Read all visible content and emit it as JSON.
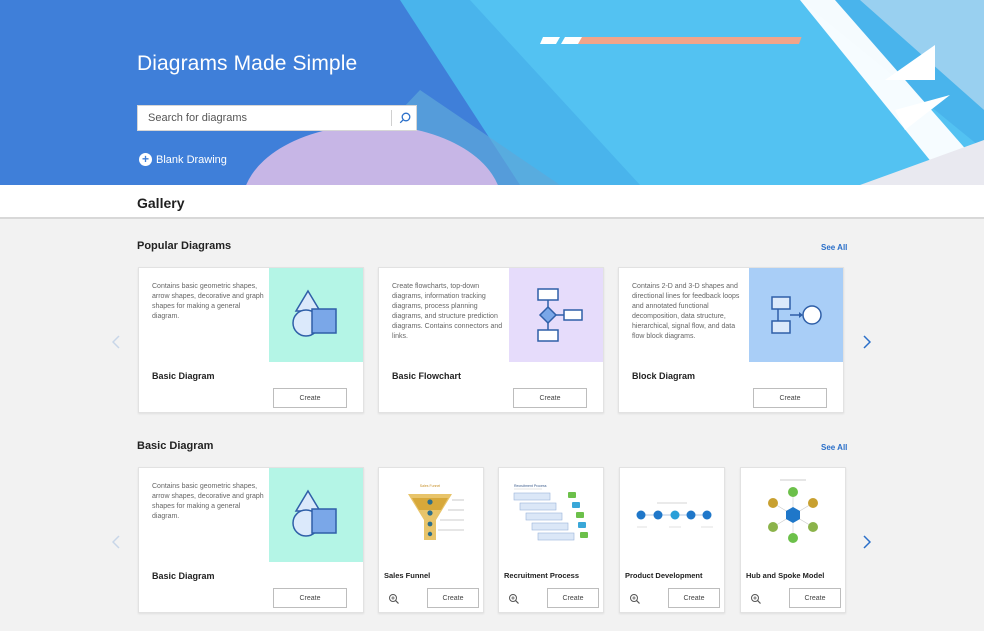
{
  "hero": {
    "title": "Diagrams Made Simple",
    "search_placeholder": "Search for diagrams",
    "blank_drawing_label": "Blank Drawing"
  },
  "gallery": {
    "title": "Gallery"
  },
  "popular": {
    "title": "Popular Diagrams",
    "see_all": "See All",
    "cards": [
      {
        "name": "Basic Diagram",
        "desc": "Contains basic geometric shapes, arrow shapes, decorative and graph shapes for making a general diagram.",
        "create": "Create"
      },
      {
        "name": "Basic Flowchart",
        "desc": "Create flowcharts, top-down diagrams, information tracking diagrams, process planning diagrams, and structure prediction diagrams. Contains connectors and links.",
        "create": "Create"
      },
      {
        "name": "Block Diagram",
        "desc": "Contains 2-D and 3-D shapes and directional lines for feedback loops and annotated functional decomposition, data structure, hierarchical, signal flow, and data flow block diagrams.",
        "create": "Create"
      }
    ]
  },
  "basic": {
    "title": "Basic Diagram",
    "see_all": "See All",
    "main_card": {
      "name": "Basic Diagram",
      "desc": "Contains basic geometric shapes, arrow shapes, decorative and graph shapes for making a general diagram.",
      "create": "Create"
    },
    "templates": [
      {
        "name": "Sales Funnel",
        "create": "Create",
        "thumb_title": "Sales Funnel"
      },
      {
        "name": "Recruitment Process",
        "create": "Create",
        "thumb_title": "Recruitment Process"
      },
      {
        "name": "Product Development",
        "create": "Create"
      },
      {
        "name": "Hub and Spoke Model",
        "create": "Create"
      }
    ]
  },
  "colors": {
    "hero_blue": "#3f7fd9",
    "accent_link": "#2a6fc9",
    "thumb_mint": "#b4f5e6",
    "thumb_lavender": "#e6dcfb",
    "thumb_blue": "#a9cef7"
  }
}
